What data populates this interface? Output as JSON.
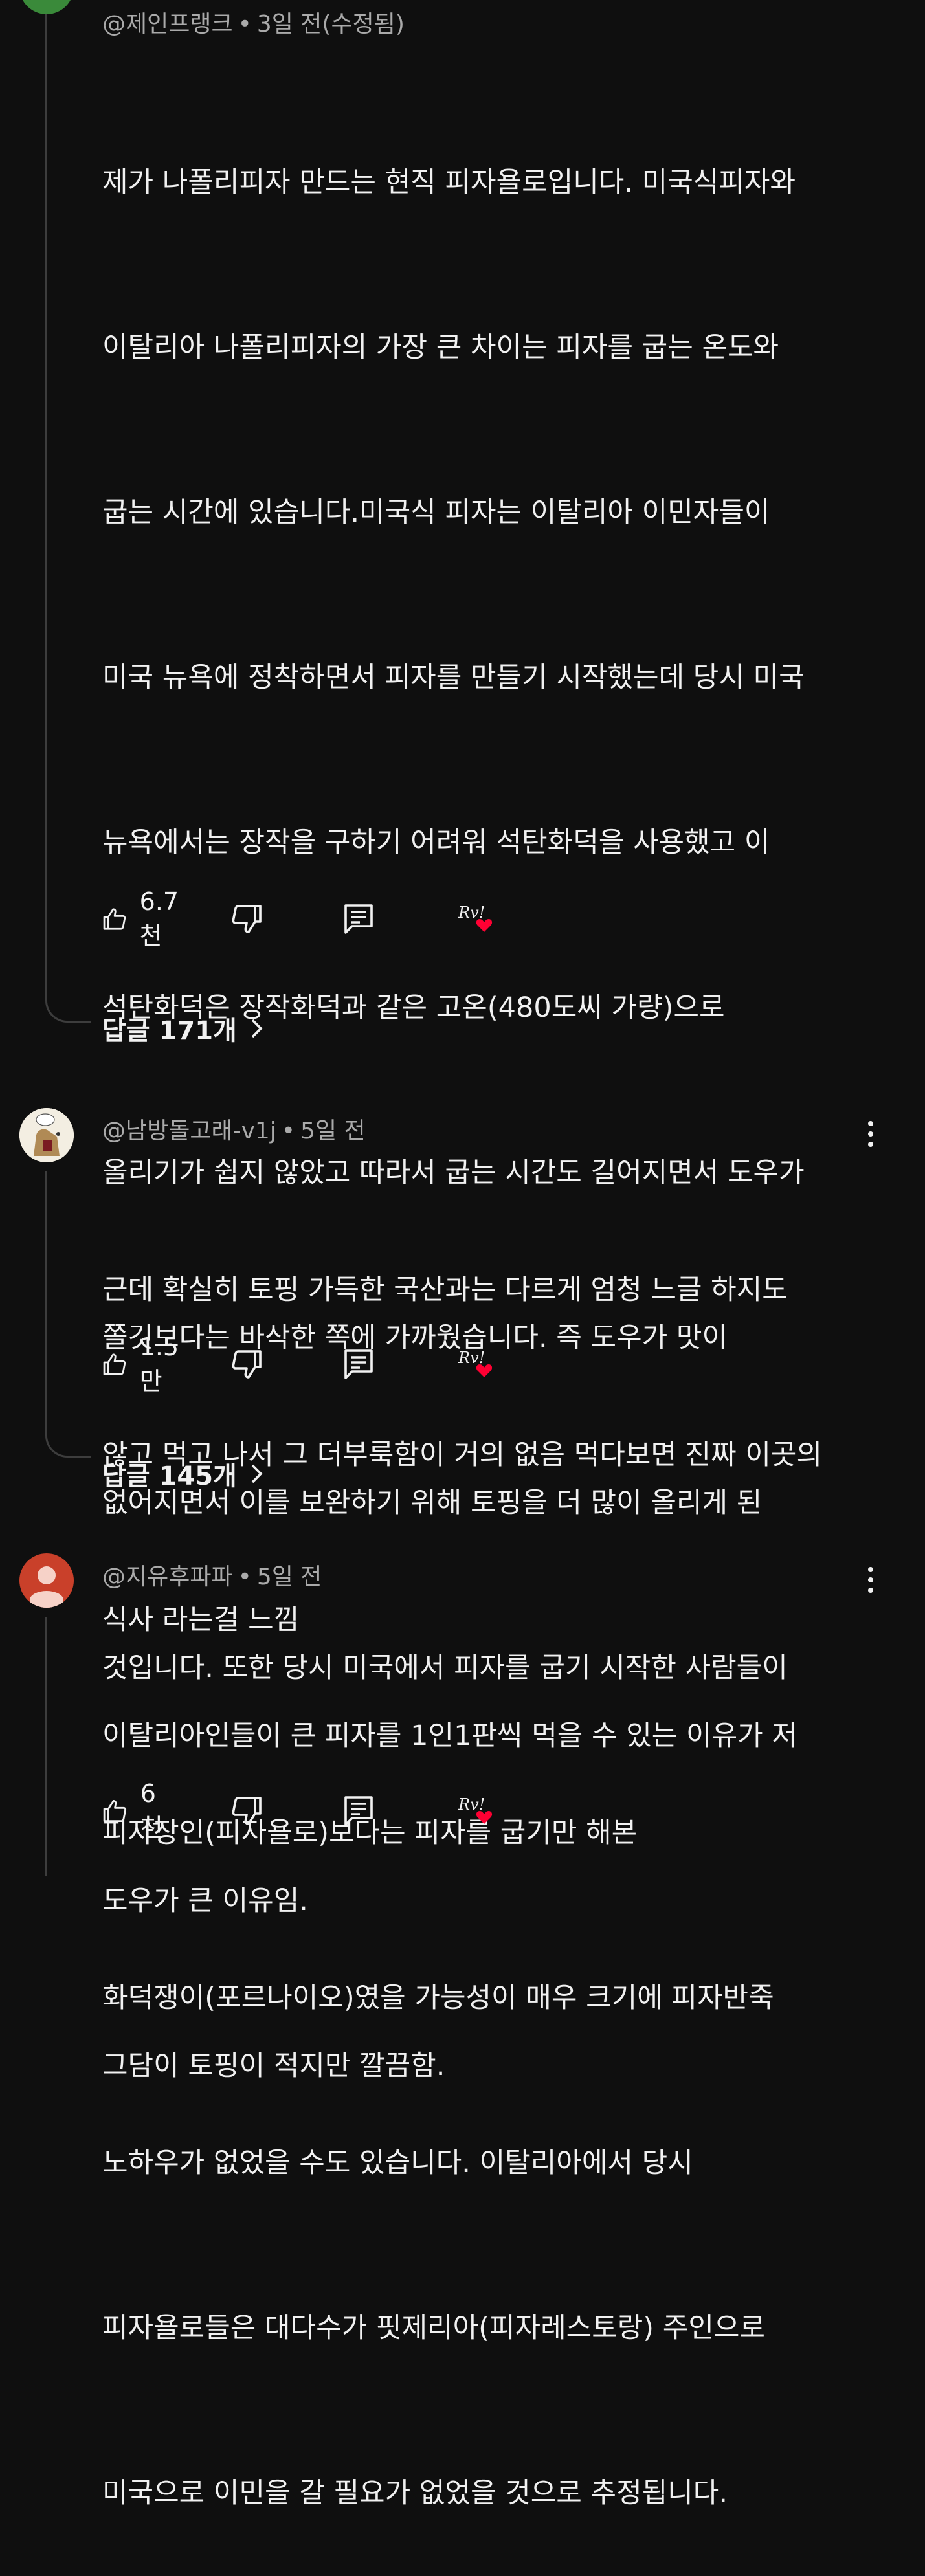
{
  "comments": [
    {
      "author": "@제인프랭크",
      "time": "3일 전(수정됨)",
      "lines": [
        "제가 나폴리피자 만드는 현직 피자욜로입니다. 미국식피자와",
        "이탈리아 나폴리피자의 가장 큰 차이는 피자를 굽는 온도와",
        "굽는 시간에 있습니다.미국식 피자는 이탈리아 이민자들이",
        "미국 뉴욕에 정착하면서 피자를 만들기 시작했는데 당시 미국",
        "뉴욕에서는 장작을 구하기 어려워 석탄화덕을 사용했고 이",
        "석탄화덕은 장작화덕과 같은 고온(480도씨 가량)으로",
        "올리기가 쉽지 않았고 따라서 굽는 시간도 길어지면서 도우가",
        "쫄깃보다는 바삭한 쪽에 가까웠습니다. 즉 도우가 맛이",
        "없어지면서 이를 보완하기 위해 토핑을 더 많이 올리게 된",
        "것입니다. 또한 당시 미국에서 피자를 굽기 시작한 사람들이",
        "피자장인(피자욜로)보다는 피자를 굽기만 해본",
        "화덕쟁이(포르나이오)였을 가능성이 매우 크기에 피자반죽",
        "노하우가 없었을 수도 있습니다. 이탈리아에서 당시",
        "피자욜로들은 대다수가 핏제리아(피자레스토랑) 주인으로",
        "미국으로 이민을 갈 필요가 없었을 것으로 추정됩니다."
      ],
      "likes": "6.7천",
      "replies": "답글 171개"
    },
    {
      "author": "@남방돌고래-v1j",
      "time": "5일 전",
      "lines": [
        "근데 확실히 토핑 가득한 국산과는 다르게 엄청 느글 하지도",
        "않고 먹고 나서 그 더부룩함이 거의 없음 먹다보면 진짜 이곳의",
        "식사 라는걸 느낌"
      ],
      "likes": "1.5만",
      "replies": "답글 145개"
    },
    {
      "author": "@지유후파파",
      "time": "5일 전",
      "lines": [
        "이탈리아인들이 큰 피자를 1인1판씩 먹을 수 있는 이유가 저",
        "도우가 큰 이유임.",
        "그담이 토핑이 적지만 깔끔함."
      ],
      "likes": "6천"
    }
  ],
  "icons": {
    "like": "thumb-up-icon",
    "dislike": "thumb-down-icon",
    "reply": "comment-icon",
    "creator_heart": "creator-heart-icon",
    "more": "more-vert-icon",
    "chevron": "chevron-right-icon"
  },
  "colors": {
    "background": "#0f0f0f",
    "text": "#f1f1f1",
    "meta": "#aaaaaa",
    "heart": "#ff0033",
    "avatar3": "#c9402a"
  }
}
